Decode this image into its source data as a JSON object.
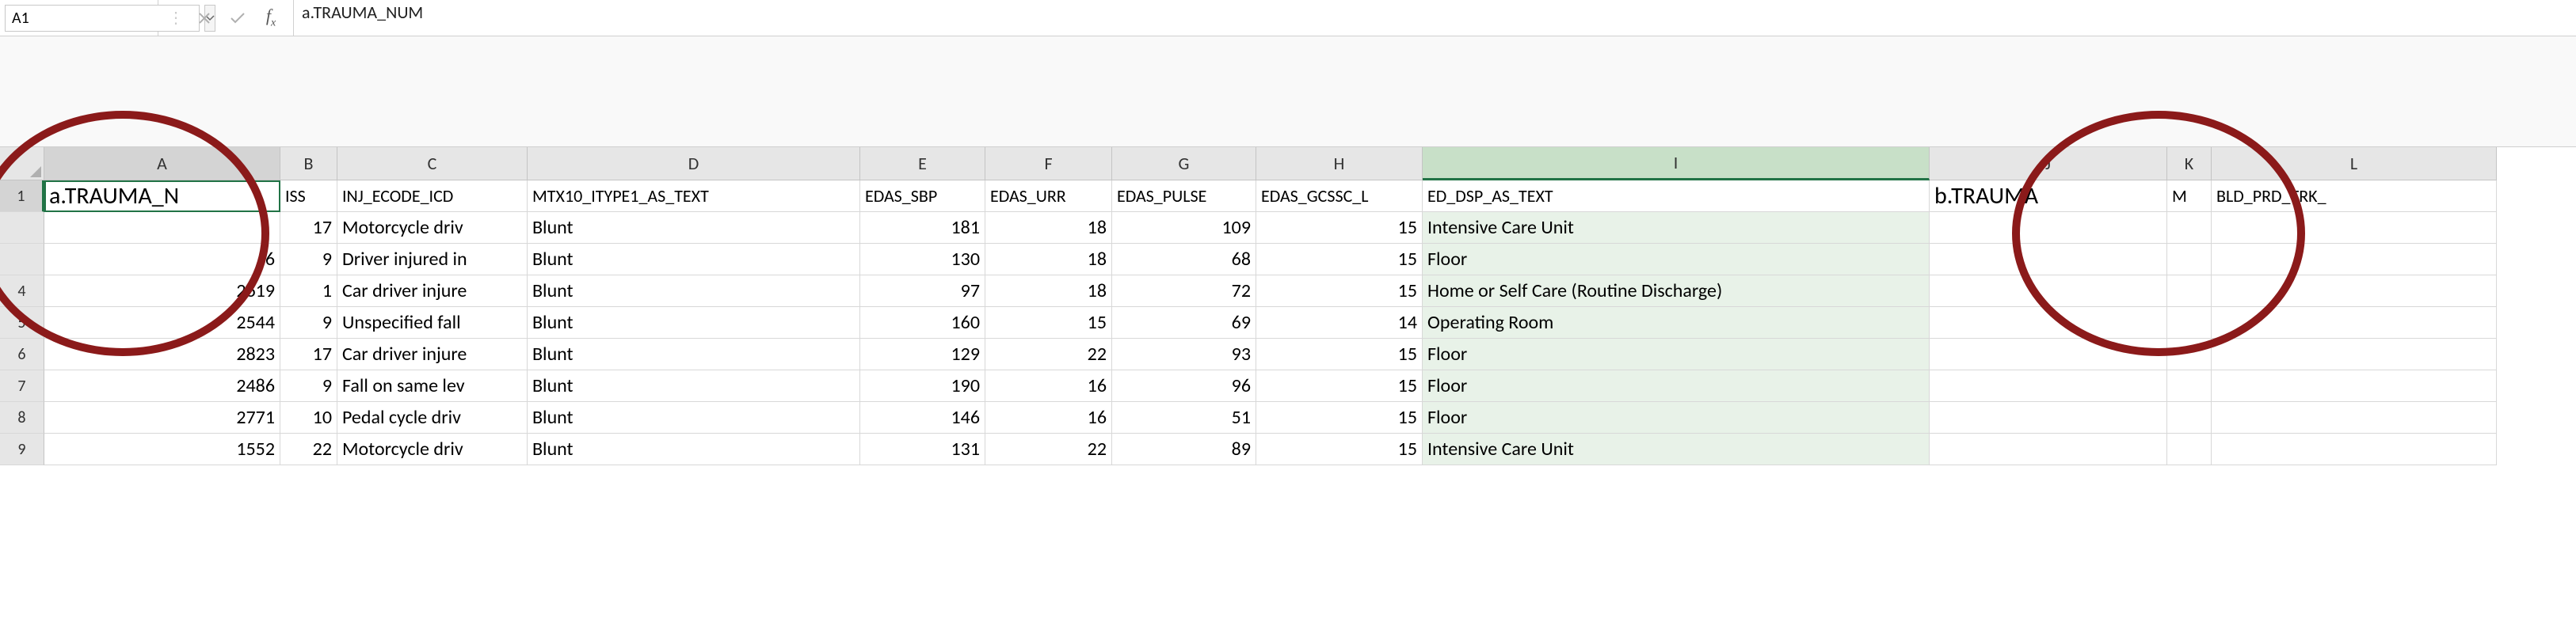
{
  "name_box": "A1",
  "formula_bar": "a.TRAUMA_NUM",
  "columns": [
    "A",
    "B",
    "C",
    "D",
    "E",
    "F",
    "G",
    "H",
    "I",
    "J",
    "K",
    "L"
  ],
  "selected_column": "I",
  "active_column": "A",
  "active_row": 1,
  "active_cell_value": "a.TRAUMA_N",
  "header_row": {
    "A": "a.TRAUMA_N",
    "B": "ISS",
    "C": "INJ_ECODE_ICD",
    "D": "MTX10_ITYPE1_AS_TEXT",
    "E": "EDAS_SBP",
    "F": "EDAS_URR",
    "G": "EDAS_PULSE",
    "H": "EDAS_GCSSC_L",
    "I": "ED_DSP_AS_TEXT",
    "J": "b.TRAUMA",
    "K": "M",
    "L": "BLD_PRD_TRK_"
  },
  "visible_row_numbers": [
    1,
    null,
    null,
    4,
    5,
    6,
    7,
    8,
    9
  ],
  "chart_data": {
    "type": "table",
    "columns": [
      "a.TRAUMA_N",
      "ISS",
      "INJ_ECODE_ICD",
      "MTX10_ITYPE1_AS_TEXT",
      "EDAS_SBP",
      "EDAS_URR",
      "EDAS_PULSE",
      "EDAS_GCSSC_L",
      "ED_DSP_AS_TEXT",
      "b.TRAUMA",
      "M",
      "BLD_PRD_TRK_"
    ],
    "rows": [
      {
        "A": "",
        "B": 17,
        "C": "Motorcycle driv",
        "D": "Blunt",
        "E": 181,
        "F": 18,
        "G": 109,
        "H": 15,
        "I": "Intensive Care Unit",
        "J": "",
        "K": "",
        "L": ""
      },
      {
        "A": "6",
        "B": 9,
        "C": "Driver injured in",
        "D": "Blunt",
        "E": 130,
        "F": 18,
        "G": 68,
        "H": 15,
        "I": "Floor",
        "J": "",
        "K": "",
        "L": ""
      },
      {
        "A": 2619,
        "B": 1,
        "C": "Car driver injure",
        "D": "Blunt",
        "E": 97,
        "F": 18,
        "G": 72,
        "H": 15,
        "I": "Home or Self Care (Routine Discharge)",
        "J": "",
        "K": "",
        "L": ""
      },
      {
        "A": 2544,
        "B": 9,
        "C": "Unspecified fall",
        "D": "Blunt",
        "E": 160,
        "F": 15,
        "G": 69,
        "H": 14,
        "I": "Operating Room",
        "J": "",
        "K": "",
        "L": ""
      },
      {
        "A": 2823,
        "B": 17,
        "C": "Car driver injure",
        "D": "Blunt",
        "E": 129,
        "F": 22,
        "G": 93,
        "H": 15,
        "I": "Floor",
        "J": "",
        "K": "",
        "L": ""
      },
      {
        "A": 2486,
        "B": 9,
        "C": "Fall on same lev",
        "D": "Blunt",
        "E": 190,
        "F": 16,
        "G": 96,
        "H": 15,
        "I": "Floor",
        "J": "",
        "K": "",
        "L": ""
      },
      {
        "A": 2771,
        "B": 10,
        "C": "Pedal cycle driv",
        "D": "Blunt",
        "E": 146,
        "F": 16,
        "G": 51,
        "H": 15,
        "I": "Floor",
        "J": "",
        "K": "",
        "L": ""
      },
      {
        "A": 1552,
        "B": 22,
        "C": "Motorcycle driv",
        "D": "Blunt",
        "E": 131,
        "F": 22,
        "G": 89,
        "H": 15,
        "I": "Intensive Care Unit",
        "J": "",
        "K": "",
        "L": ""
      }
    ]
  }
}
